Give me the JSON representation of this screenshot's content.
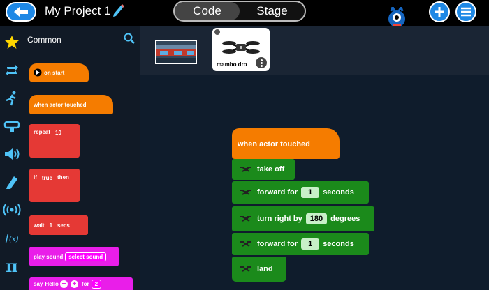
{
  "header": {
    "project_title": "My Project 1",
    "tabs": [
      {
        "label": "Code",
        "active": true
      },
      {
        "label": "Stage",
        "active": false
      }
    ],
    "colors": {
      "accent": "#1e88e5"
    }
  },
  "palette": {
    "category": "Common",
    "blocks": [
      {
        "text": "on start",
        "color": "#f57c00"
      },
      {
        "text": "when actor touched",
        "color": "#f57c00"
      },
      {
        "text": "repeat",
        "value": "10",
        "color": "#e53935"
      },
      {
        "text_if": "if",
        "value": "true",
        "text_then": "then",
        "color": "#e53935"
      },
      {
        "text": "wait",
        "value": "1",
        "suffix": "secs",
        "color": "#e53935"
      },
      {
        "text": "play sound",
        "value": "select sound",
        "color": "#e91ee9"
      },
      {
        "text": "say",
        "value": "Hello",
        "text_for": "for",
        "value2": "2",
        "color": "#e91ee9"
      }
    ]
  },
  "actors": {
    "selected_name": "mambo dro"
  },
  "script": {
    "hat": "when actor touched",
    "take_off": "take off",
    "fwd_label": "forward for",
    "fwd_value": "1",
    "seconds": "seconds",
    "turn_label": "turn right by",
    "turn_value": "180",
    "degrees": "degrees",
    "fwd2_value": "1",
    "land": "land"
  },
  "icons": [
    "back-arrow-icon",
    "pencil-icon",
    "plus-icon",
    "menu-icon",
    "star-icon",
    "search-icon",
    "loop-icon",
    "runner-icon",
    "looks-icon",
    "speaker-icon",
    "pen-icon",
    "broadcast-icon",
    "function-icon",
    "pi-icon",
    "drone-icon",
    "mascot-icon",
    "more-icon"
  ]
}
